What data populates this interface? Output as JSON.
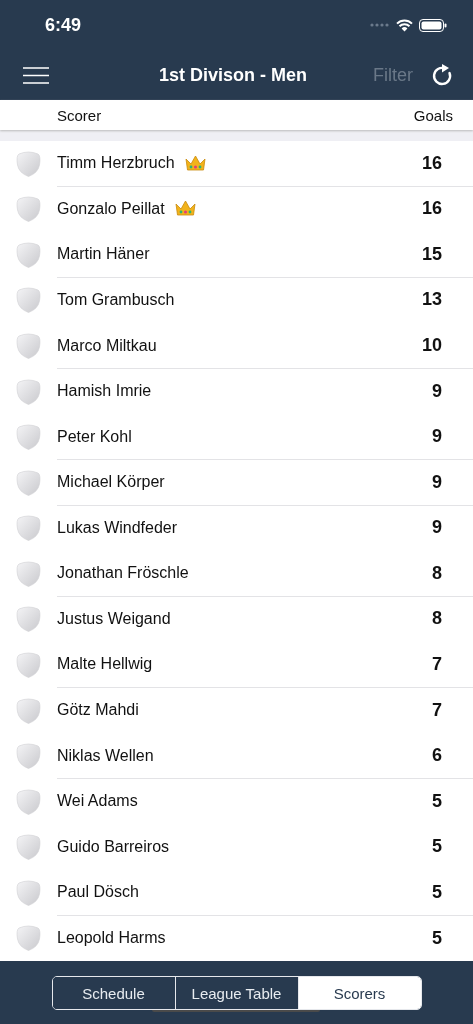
{
  "status_bar": {
    "time": "6:49"
  },
  "nav": {
    "title": "1st Divison - Men",
    "filter": "Filter",
    "filter_disabled": true
  },
  "table": {
    "columns": [
      "Scorer",
      "Goals"
    ],
    "rows": [
      {
        "name": "Timm Herzbruch",
        "goals": "16",
        "leader": true
      },
      {
        "name": "Gonzalo Peillat",
        "goals": "16",
        "leader": true
      },
      {
        "name": "Martin Häner",
        "goals": "15",
        "leader": false
      },
      {
        "name": "Tom Grambusch",
        "goals": "13",
        "leader": false
      },
      {
        "name": "Marco Miltkau",
        "goals": "10",
        "leader": false
      },
      {
        "name": "Hamish Imrie",
        "goals": "9",
        "leader": false
      },
      {
        "name": "Peter Kohl",
        "goals": "9",
        "leader": false
      },
      {
        "name": "Michael Körper",
        "goals": "9",
        "leader": false
      },
      {
        "name": "Lukas Windfeder",
        "goals": "9",
        "leader": false
      },
      {
        "name": "Jonathan Fröschle",
        "goals": "8",
        "leader": false
      },
      {
        "name": "Justus Weigand",
        "goals": "8",
        "leader": false
      },
      {
        "name": "Malte Hellwig",
        "goals": "7",
        "leader": false
      },
      {
        "name": "Götz Mahdi",
        "goals": "7",
        "leader": false
      },
      {
        "name": "Niklas Wellen",
        "goals": "6",
        "leader": false
      },
      {
        "name": "Wei Adams",
        "goals": "5",
        "leader": false
      },
      {
        "name": "Guido Barreiros",
        "goals": "5",
        "leader": false
      },
      {
        "name": "Paul Dösch",
        "goals": "5",
        "leader": false
      },
      {
        "name": "Leopold Harms",
        "goals": "5",
        "leader": false
      }
    ]
  },
  "tabs": [
    {
      "label": "Schedule",
      "selected": false
    },
    {
      "label": "League Table",
      "selected": false
    },
    {
      "label": "Scorers",
      "selected": true
    }
  ]
}
